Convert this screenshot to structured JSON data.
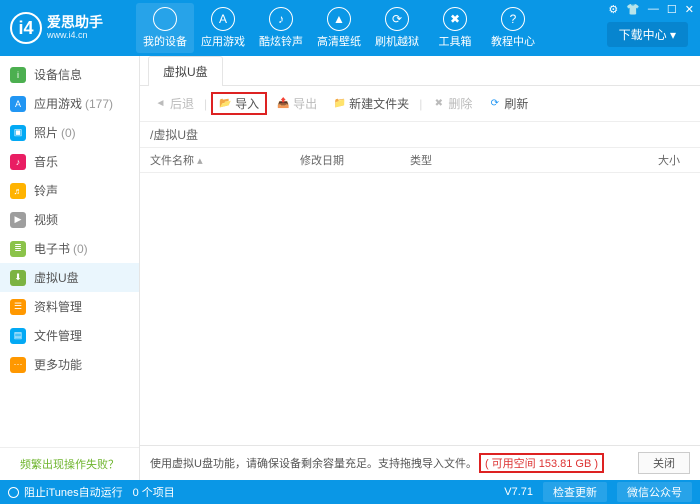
{
  "app": {
    "name_cn": "爱思助手",
    "site": "www.i4.cn"
  },
  "topnav": [
    {
      "label": "我的设备",
      "icon": ""
    },
    {
      "label": "应用游戏",
      "icon": "A"
    },
    {
      "label": "酷炫铃声",
      "icon": "♪"
    },
    {
      "label": "高清壁纸",
      "icon": "▲"
    },
    {
      "label": "刷机越狱",
      "icon": "⟳"
    },
    {
      "label": "工具箱",
      "icon": "✖"
    },
    {
      "label": "教程中心",
      "icon": "?"
    }
  ],
  "download_center": "下载中心 ▾",
  "sidebar": [
    {
      "label": "设备信息",
      "count": "",
      "color": "#4caf50",
      "glyph": "i"
    },
    {
      "label": "应用游戏",
      "count": "(177)",
      "color": "#2196f3",
      "glyph": "A"
    },
    {
      "label": "照片",
      "count": "(0)",
      "color": "#03a9f4",
      "glyph": "▣"
    },
    {
      "label": "音乐",
      "count": "",
      "color": "#e91e63",
      "glyph": "♪"
    },
    {
      "label": "铃声",
      "count": "",
      "color": "#ffb300",
      "glyph": "♬"
    },
    {
      "label": "视频",
      "count": "",
      "color": "#9e9e9e",
      "glyph": "▶"
    },
    {
      "label": "电子书",
      "count": "(0)",
      "color": "#8bc34a",
      "glyph": "≣"
    },
    {
      "label": "虚拟U盘",
      "count": "",
      "color": "#7cb342",
      "glyph": "⬇"
    },
    {
      "label": "资料管理",
      "count": "",
      "color": "#ff9800",
      "glyph": "☰"
    },
    {
      "label": "文件管理",
      "count": "",
      "color": "#03a9f4",
      "glyph": "▤"
    },
    {
      "label": "更多功能",
      "count": "",
      "color": "#ff9800",
      "glyph": "⋯"
    }
  ],
  "sidebar_active": 7,
  "sidebar_footer": "频繁出现操作失败？",
  "tabs": {
    "active": "虚拟U盘"
  },
  "toolbar": {
    "back": "后退",
    "import": "导入",
    "export": "导出",
    "newfolder": "新建文件夹",
    "delete": "删除",
    "refresh": "刷新"
  },
  "path": "/虚拟U盘",
  "columns": {
    "name": "文件名称",
    "date": "修改日期",
    "type": "类型",
    "size": "大小"
  },
  "bottom": {
    "hint_pre": "使用虚拟U盘功能，请确保设备剩余容量充足。支持拖拽导入文件。",
    "free_space": "( 可用空间 153.81 GB )",
    "close": "关闭"
  },
  "status": {
    "itunes": "阻止iTunes自动运行",
    "items": "0 个项目",
    "version": "V7.71",
    "check_update": "检查更新",
    "wechat": "微信公众号"
  }
}
